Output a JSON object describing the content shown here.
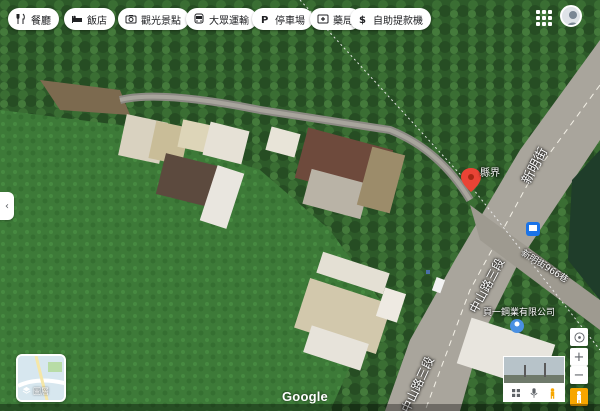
{
  "chips": [
    {
      "icon": "restaurant-icon",
      "label": "餐廳"
    },
    {
      "icon": "hotel-icon",
      "label": "飯店"
    },
    {
      "icon": "camera-icon",
      "label": "觀光景點"
    },
    {
      "icon": "bus-icon",
      "label": "大眾運輸"
    },
    {
      "icon": "parking-icon",
      "label": "停車場"
    },
    {
      "icon": "pharmacy-icon",
      "label": "藥局"
    },
    {
      "icon": "cash-icon",
      "label": "自助提款機"
    }
  ],
  "top_right": {
    "apps_icon": "apps-grid-icon",
    "avatar_icon": "account-avatar"
  },
  "map": {
    "pin_label": "縣界",
    "road_xinming": "新明街",
    "road_xinming_lane": "新明街966巷",
    "road_zhongshan_upper": "中山路三段",
    "road_zhongshan_lower": "中山路三段",
    "company_label": "頁一鋼業有限公司",
    "pin_color": "#ea4335",
    "bus_color": "#1a73e8",
    "poi_color": "#4a90e2"
  },
  "layers": {
    "label": "圖層"
  },
  "brand": {
    "logo_text": "Google"
  },
  "controls": {
    "compass_icon": "compass-icon",
    "zoom_in": "+",
    "zoom_out": "−",
    "pegman_icon": "pegman-icon",
    "collapse": "‹"
  },
  "search_bar": {
    "icons": [
      "grid-icon",
      "mic-icon",
      "pegman-icon"
    ]
  }
}
